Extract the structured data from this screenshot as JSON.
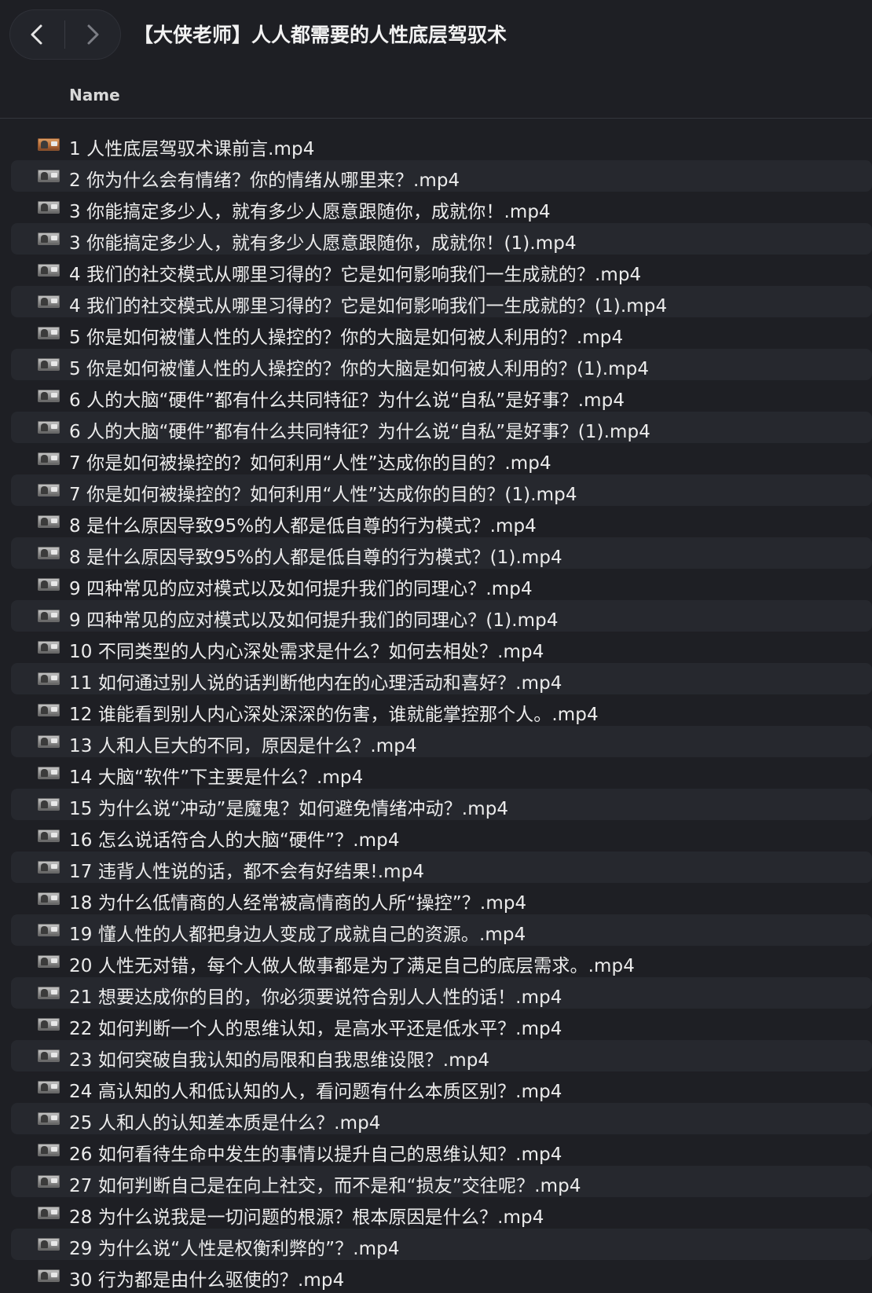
{
  "window": {
    "title": "【大侠老师】人人都需要的人性底层驾驭术"
  },
  "header": {
    "column_name": "Name"
  },
  "files": [
    {
      "name": "1 人性底层驾驭术课前言.mp4"
    },
    {
      "name": "2 你为什么会有情绪？你的情绪从哪里来？.mp4"
    },
    {
      "name": "3 你能搞定多少人，就有多少人愿意跟随你，成就你！.mp4"
    },
    {
      "name": "3 你能搞定多少人，就有多少人愿意跟随你，成就你！(1).mp4"
    },
    {
      "name": "4 我们的社交模式从哪里习得的？它是如何影响我们一生成就的？.mp4"
    },
    {
      "name": "4 我们的社交模式从哪里习得的？它是如何影响我们一生成就的？(1).mp4"
    },
    {
      "name": "5 你是如何被懂人性的人操控的？你的大脑是如何被人利用的？.mp4"
    },
    {
      "name": "5 你是如何被懂人性的人操控的？你的大脑是如何被人利用的？(1).mp4"
    },
    {
      "name": "6 人的大脑“硬件”都有什么共同特征？为什么说“自私”是好事？.mp4"
    },
    {
      "name": "6 人的大脑“硬件”都有什么共同特征？为什么说“自私”是好事？(1).mp4"
    },
    {
      "name": "7 你是如何被操控的？如何利用“人性”达成你的目的？.mp4"
    },
    {
      "name": "7 你是如何被操控的？如何利用“人性”达成你的目的？(1).mp4"
    },
    {
      "name": "8 是什么原因导致95%的人都是低自尊的行为模式？.mp4"
    },
    {
      "name": "8 是什么原因导致95%的人都是低自尊的行为模式？(1).mp4"
    },
    {
      "name": "9 四种常见的应对模式以及如何提升我们的同理心？.mp4"
    },
    {
      "name": "9 四种常见的应对模式以及如何提升我们的同理心？(1).mp4"
    },
    {
      "name": "10 不同类型的人内心深处需求是什么？如何去相处？.mp4"
    },
    {
      "name": "11 如何通过别人说的话判断他内在的心理活动和喜好？.mp4"
    },
    {
      "name": "12 谁能看到别人内心深处深深的伤害，谁就能掌控那个人。.mp4"
    },
    {
      "name": "13 人和人巨大的不同，原因是什么？.mp4"
    },
    {
      "name": "14 大脑“软件”下主要是什么？.mp4"
    },
    {
      "name": "15 为什么说“冲动”是魔鬼？如何避免情绪冲动？.mp4"
    },
    {
      "name": "16 怎么说话符合人的大脑“硬件”？.mp4"
    },
    {
      "name": "17 违背人性说的话，都不会有好结果!.mp4"
    },
    {
      "name": "18 为什么低情商的人经常被高情商的人所“操控”？.mp4"
    },
    {
      "name": "19 懂人性的人都把身边人变成了成就自己的资源。.mp4"
    },
    {
      "name": "20 人性无对错，每个人做人做事都是为了满足自己的底层需求。.mp4"
    },
    {
      "name": "21 想要达成你的目的，你必须要说符合别人人性的话！.mp4"
    },
    {
      "name": "22 如何判断一个人的思维认知，是高水平还是低水平？.mp4"
    },
    {
      "name": "23 如何突破自我认知的局限和自我思维设限？.mp4"
    },
    {
      "name": "24 高认知的人和低认知的人，看问题有什么本质区别？.mp4"
    },
    {
      "name": "25 人和人的认知差本质是什么？.mp4"
    },
    {
      "name": "26 如何看待生命中发生的事情以提升自己的思维认知？.mp4"
    },
    {
      "name": "27 如何判断自己是在向上社交，而不是和“损友”交往呢？.mp4"
    },
    {
      "name": "28 为什么说我是一切问题的根源？根本原因是什么？.mp4"
    },
    {
      "name": "29 为什么说“人性是权衡利弊的”？.mp4"
    },
    {
      "name": "30 行为都是由什么驱使的？.mp4"
    }
  ],
  "icons": {
    "back": "chevron-left-icon",
    "forward": "chevron-right-icon",
    "file_thumbnail": "video-thumbnail-icon"
  },
  "colors": {
    "background": "#1e1f24",
    "row_alt": "#26282e",
    "text": "#ececec"
  }
}
